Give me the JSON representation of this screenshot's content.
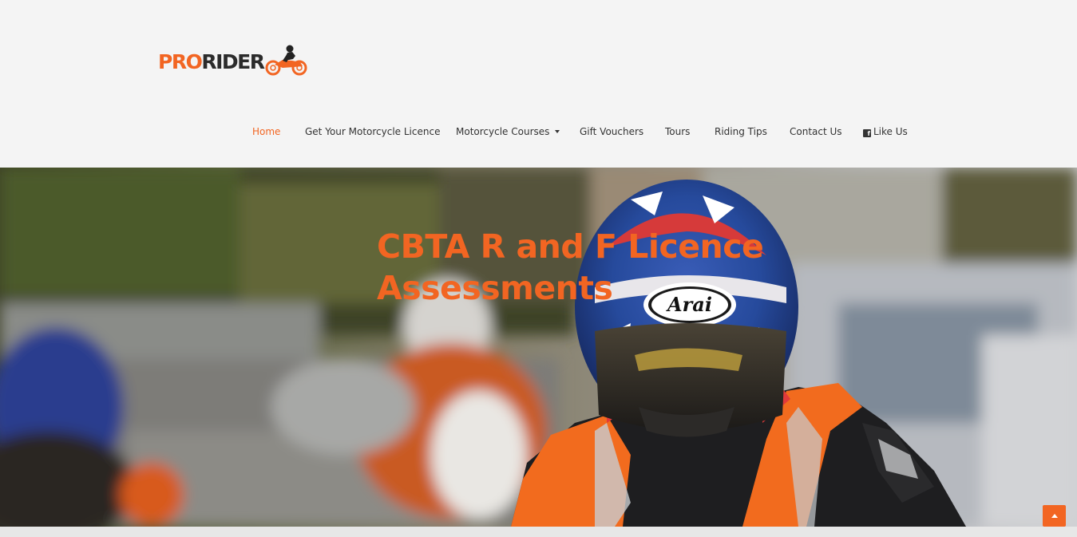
{
  "brand": {
    "logo_pro": "PRO",
    "logo_rider": "RIDER",
    "logo_icon": "motorcycle-rider-icon"
  },
  "nav": {
    "items": [
      {
        "label": "Home",
        "active": true
      },
      {
        "label": "Get Your Motorcycle Licence"
      },
      {
        "label": "Motorcycle Courses",
        "icon": "caret-down-icon"
      },
      {
        "label": "Gift Vouchers"
      },
      {
        "label": "Tours"
      },
      {
        "label": "Riding Tips"
      },
      {
        "label": "Contact Us"
      },
      {
        "label": "Like Us",
        "icon": "facebook-icon"
      }
    ]
  },
  "hero": {
    "title_line1": "CBTA R and F Licence",
    "title_line2": "Assessments",
    "helmet_brand": "Arai"
  },
  "scroll_top": {
    "icon": "chevron-up-icon"
  },
  "colors": {
    "accent": "#f26522",
    "header_bg": "#f4f4f4",
    "nav_text": "#333333"
  }
}
